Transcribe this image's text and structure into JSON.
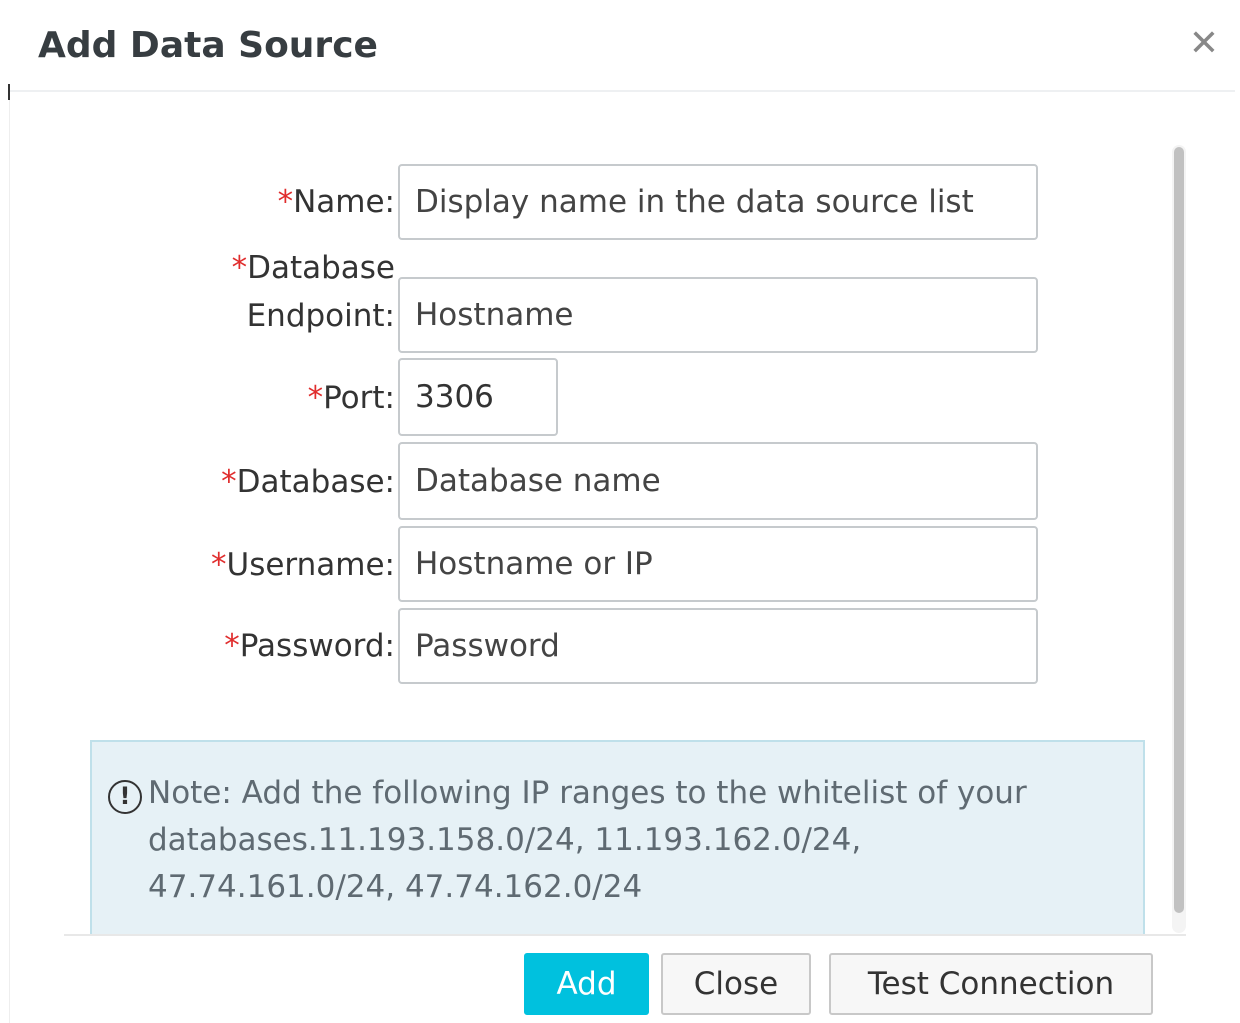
{
  "dialog": {
    "title": "Add Data Source",
    "close_glyph": "✕"
  },
  "form": {
    "required_marker": "*",
    "name": {
      "label": "Name:",
      "placeholder": "Display name in the data source list"
    },
    "endpoint": {
      "label_line1": "Database",
      "label_line2": "Endpoint:",
      "placeholder": "Hostname"
    },
    "port": {
      "label": "Port:",
      "value": "3306"
    },
    "database": {
      "label": "Database:",
      "placeholder": "Database name"
    },
    "username": {
      "label": "Username:",
      "placeholder": "Hostname or IP"
    },
    "password": {
      "label": "Password:",
      "placeholder": "Password"
    }
  },
  "note": {
    "icon": "!",
    "line1": "Note: Add the following IP ranges to the whitelist of your",
    "line2": "databases.11.193.158.0/24, 11.193.162.0/24,",
    "line3": "47.74.161.0/24, 47.74.162.0/24"
  },
  "footer": {
    "add_label": "Add",
    "close_label": "Close",
    "test_label": "Test Connection"
  },
  "colors": {
    "primary": "#00c1de",
    "required": "#e02d2d",
    "note_bg": "#e6f1f6"
  }
}
